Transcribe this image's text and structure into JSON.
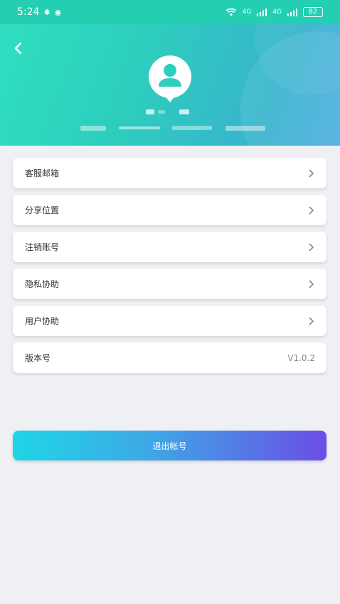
{
  "status_bar": {
    "time": "5:24",
    "network1": "4G",
    "network2": "4G",
    "battery": "82"
  },
  "header": {
    "back_icon": "chevron-left-icon",
    "avatar_icon": "user-pin-icon"
  },
  "menu": {
    "items": [
      {
        "label": "客服邮箱"
      },
      {
        "label": "分享位置"
      },
      {
        "label": "注销账号"
      },
      {
        "label": "隐私协助"
      },
      {
        "label": "用户协助"
      }
    ],
    "version": {
      "label": "版本号",
      "value": "V1.0.2"
    }
  },
  "logout": {
    "label": "退出帐号"
  },
  "colors": {
    "accent_start": "#1ed6e6",
    "accent_end": "#6a4ee6",
    "header_start": "#2fe0c0",
    "header_end": "#4eaee0"
  }
}
